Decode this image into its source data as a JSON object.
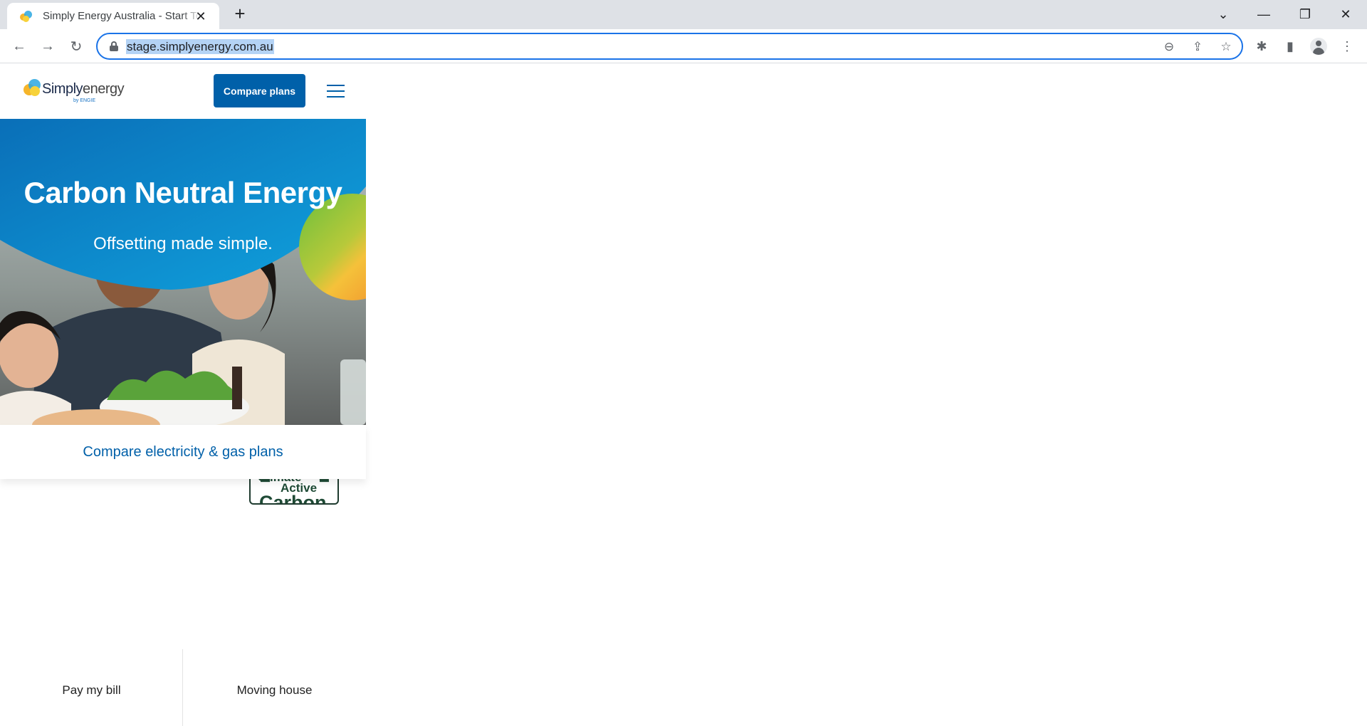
{
  "browser": {
    "tab_title": "Simply Energy Australia - Start Today",
    "url": "stage.simplyenergy.com.au",
    "new_tab_symbol": "+",
    "tab_close_symbol": "✕",
    "controls": {
      "tab_list": "⌄",
      "minimize": "—",
      "restore": "❐",
      "close": "✕"
    },
    "nav": {
      "back": "←",
      "forward": "→",
      "reload": "↻"
    },
    "omnibox_icons": {
      "zoom": "⊖",
      "share": "⇪",
      "bookmark": "☆"
    },
    "toolbar_icons": {
      "extensions": "✱",
      "side_panel": "▮",
      "menu": "⋮"
    }
  },
  "site": {
    "logo": {
      "simply": "Simply",
      "energy": "energy",
      "byline": "by ENGIE"
    },
    "header": {
      "compare_button": "Compare plans"
    },
    "hero": {
      "title": "Carbon Neutral Energy",
      "subtitle": "Offsetting made simple.",
      "badge": {
        "line1": "Climate",
        "line2": "Active",
        "line3": "Carbon"
      }
    },
    "compare_link": "Compare electricity & gas plans",
    "quick_links": [
      "Pay my bill",
      "Moving house"
    ]
  },
  "colors": {
    "brand_blue": "#0060a9",
    "hero_blue": "#0a8bd0",
    "accent_green": "#6cbf3c",
    "accent_orange": "#f4a530"
  }
}
